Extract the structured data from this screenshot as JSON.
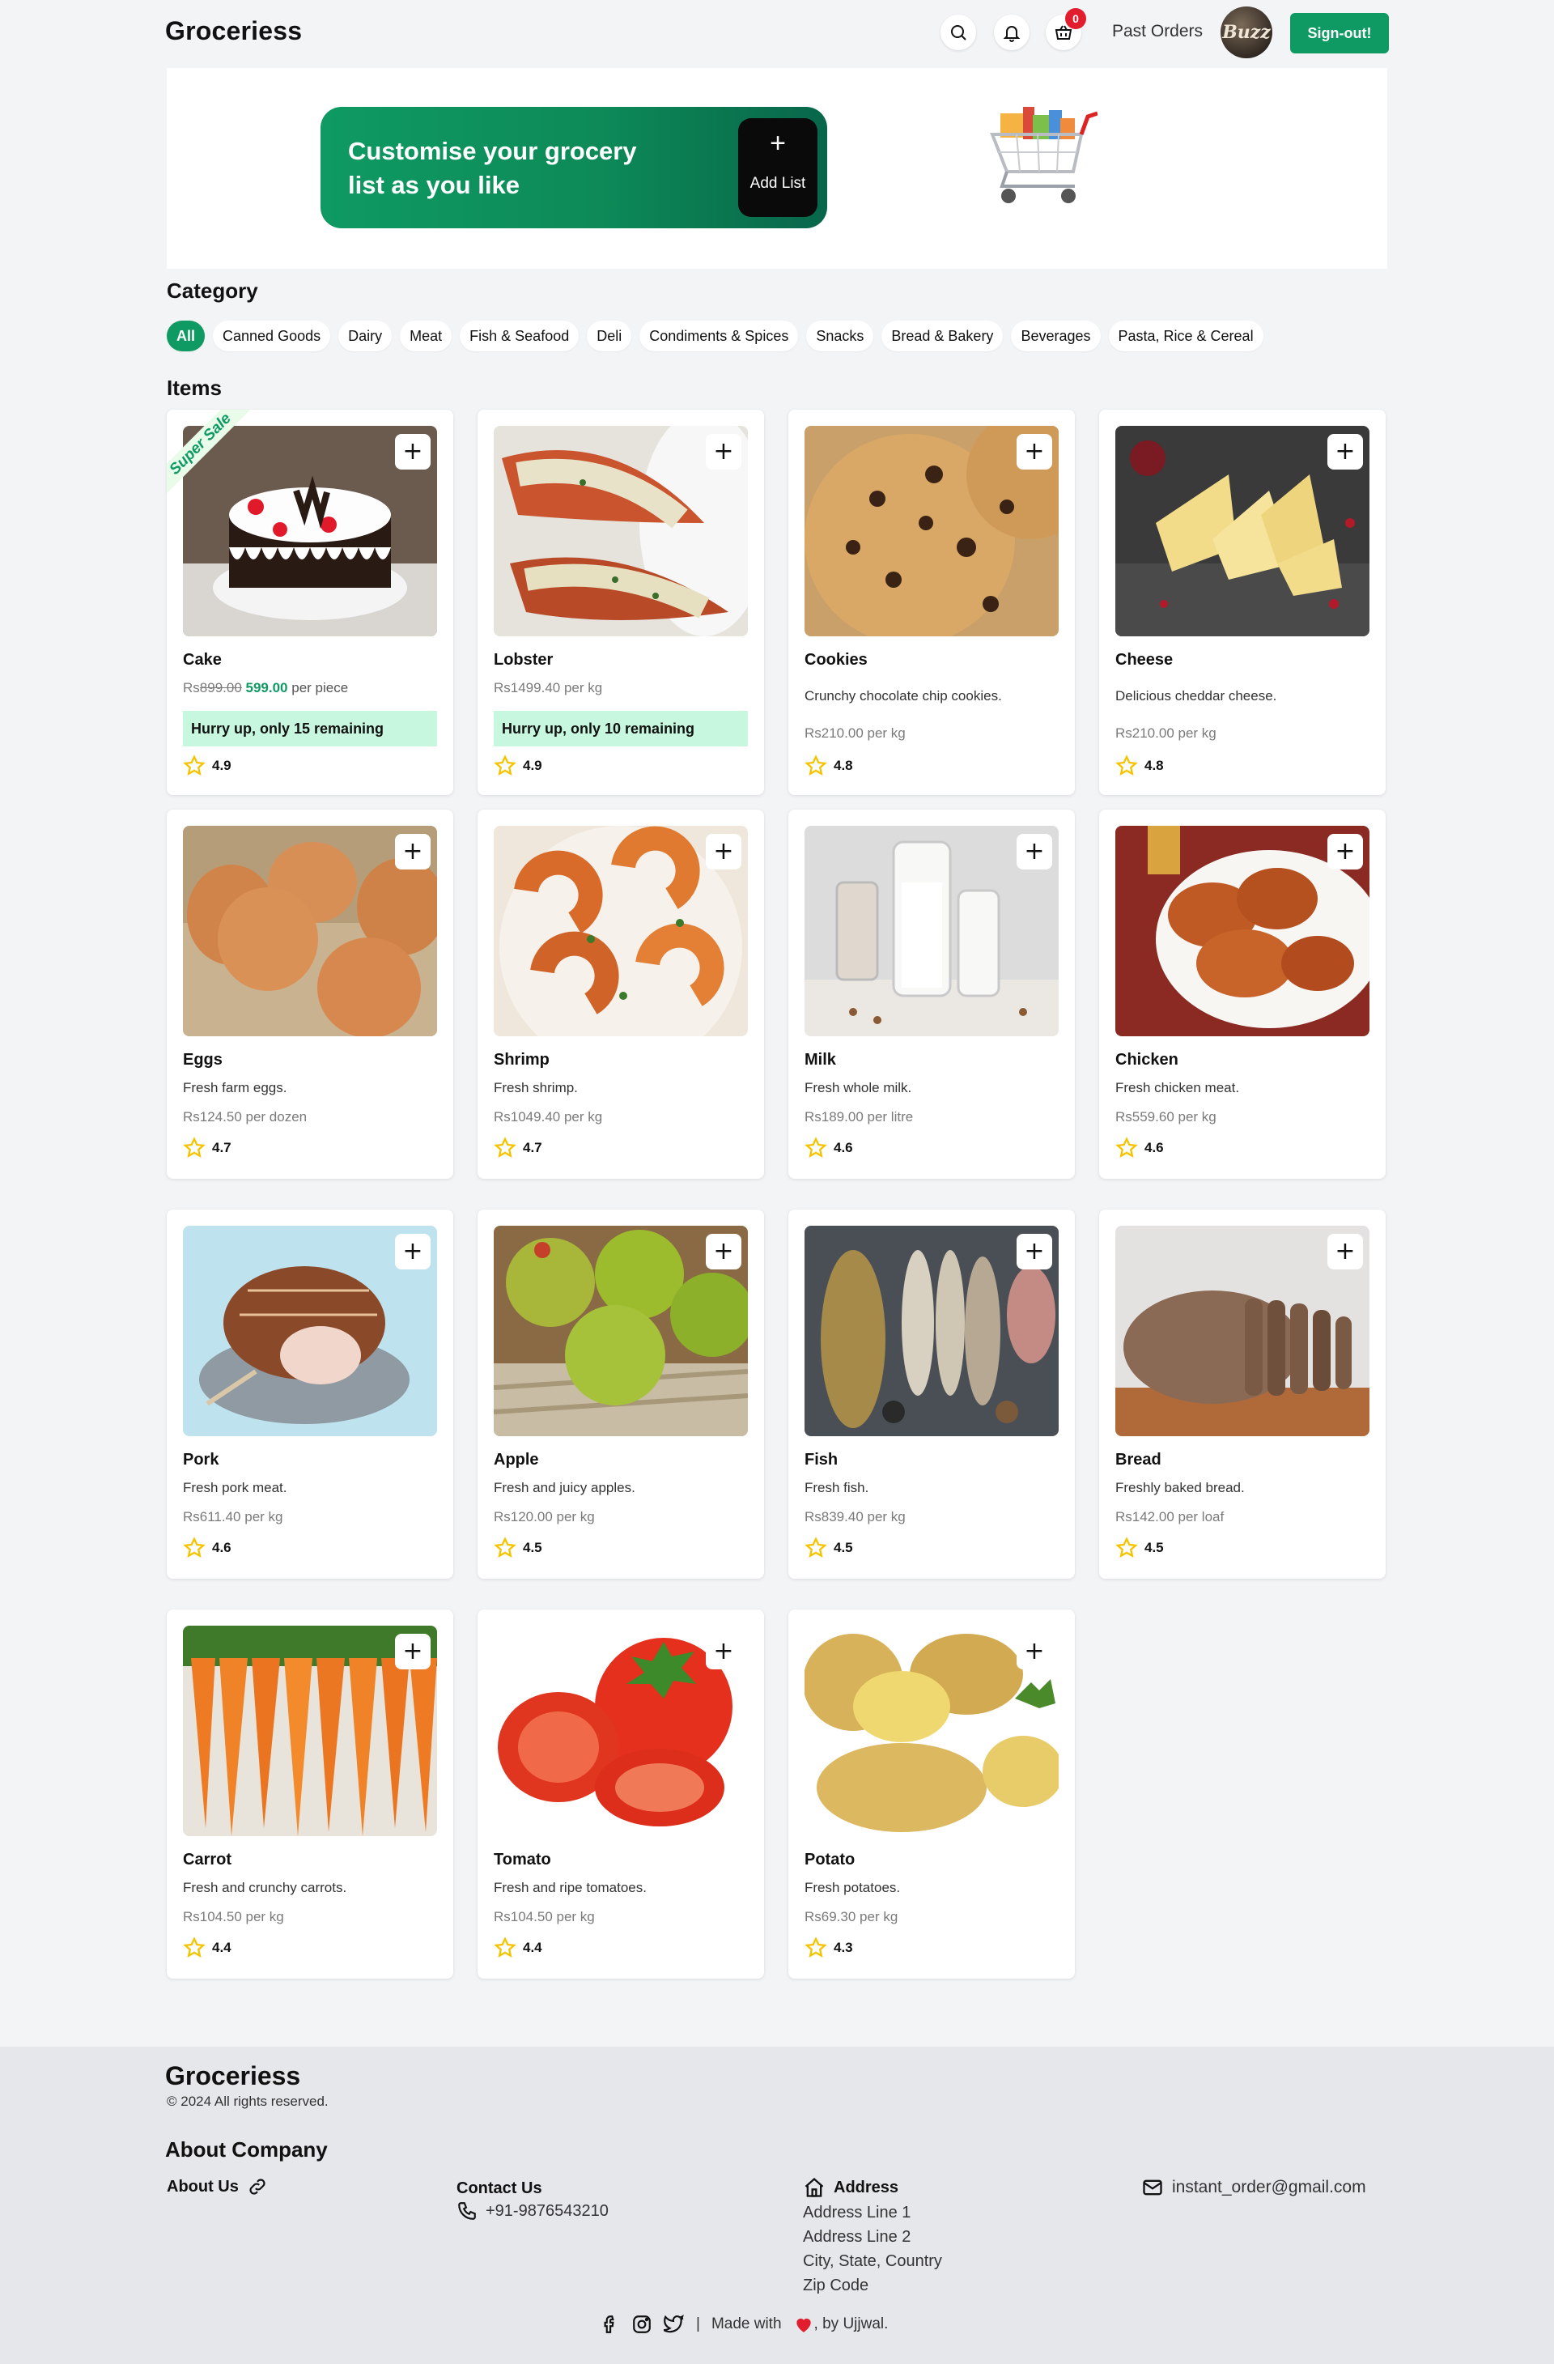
{
  "app": {
    "brand": "Groceriess"
  },
  "header": {
    "cart_count": "0",
    "past_orders": "Past Orders",
    "avatar_text": "Buzz",
    "signout": "Sign-out!",
    "icons": [
      "search-icon",
      "bell-icon",
      "basket-icon"
    ]
  },
  "banner": {
    "promo_text": "Customise your grocery list as you like",
    "add_plus": "+",
    "add_label": "Add List"
  },
  "category": {
    "title": "Category",
    "items": [
      "All",
      "Canned Goods",
      "Dairy",
      "Meat",
      "Fish & Seafood",
      "Deli",
      "Condiments & Spices",
      "Snacks",
      "Bread & Bakery",
      "Beverages",
      "Pasta, Rice & Cereal"
    ],
    "active": "All"
  },
  "items_title": "Items",
  "currency": "Rs",
  "items": [
    {
      "name": "Cake",
      "old_price": "899.00",
      "price": "599.00",
      "unit": "per piece",
      "hurry": "Hurry up, only 15 remaining",
      "rating": "4.9",
      "sale": "Super Sale"
    },
    {
      "name": "Lobster",
      "price": "Rs1499.40 per kg",
      "hurry": "Hurry up, only 10 remaining",
      "rating": "4.9"
    },
    {
      "name": "Cookies",
      "desc": "Crunchy chocolate chip cookies.",
      "price": "Rs210.00 per kg",
      "rating": "4.8"
    },
    {
      "name": "Cheese",
      "desc": "Delicious cheddar cheese.",
      "price": "Rs210.00 per kg",
      "rating": "4.8"
    },
    {
      "name": "Eggs",
      "desc": "Fresh farm eggs.",
      "price": "Rs124.50 per dozen",
      "rating": "4.7"
    },
    {
      "name": "Shrimp",
      "desc": "Fresh shrimp.",
      "price": "Rs1049.40 per kg",
      "rating": "4.7"
    },
    {
      "name": "Milk",
      "desc": "Fresh whole milk.",
      "price": "Rs189.00 per litre",
      "rating": "4.6"
    },
    {
      "name": "Chicken",
      "desc": "Fresh chicken meat.",
      "price": "Rs559.60 per kg",
      "rating": "4.6"
    },
    {
      "name": "Pork",
      "desc": "Fresh pork meat.",
      "price": "Rs611.40 per kg",
      "rating": "4.6"
    },
    {
      "name": "Apple",
      "desc": "Fresh and juicy apples.",
      "price": "Rs120.00 per kg",
      "rating": "4.5"
    },
    {
      "name": "Fish",
      "desc": "Fresh fish.",
      "price": "Rs839.40 per kg",
      "rating": "4.5"
    },
    {
      "name": "Bread",
      "desc": "Freshly baked bread.",
      "price": "Rs142.00 per loaf",
      "rating": "4.5"
    },
    {
      "name": "Carrot",
      "desc": "Fresh and crunchy carrots.",
      "price": "Rs104.50 per kg",
      "rating": "4.4"
    },
    {
      "name": "Tomato",
      "desc": "Fresh and ripe tomatoes.",
      "price": "Rs104.50 per kg",
      "rating": "4.4"
    },
    {
      "name": "Potato",
      "desc": "Fresh potatoes.",
      "price": "Rs69.30 per kg",
      "rating": "4.3"
    }
  ],
  "add_button": "+",
  "colors": {
    "accent": "#0f9a63",
    "badge": "#e11d2e",
    "hurry_bg": "#c8f7df",
    "star": "#f5c400"
  },
  "footer": {
    "brand": "Groceriess",
    "copyright": "© 2024  All rights reserved.",
    "about_company": "About Company",
    "about_us": "About Us",
    "contact_title": "Contact Us",
    "phone": "+91-9876543210",
    "address_title": "Address",
    "address_lines": [
      "Address Line 1",
      "Address Line 2",
      "City, State, Country",
      "Zip Code"
    ],
    "email": "instant_order@gmail.com",
    "separator": "|",
    "made_with": "Made with",
    "by": ", by Ujjwal."
  }
}
